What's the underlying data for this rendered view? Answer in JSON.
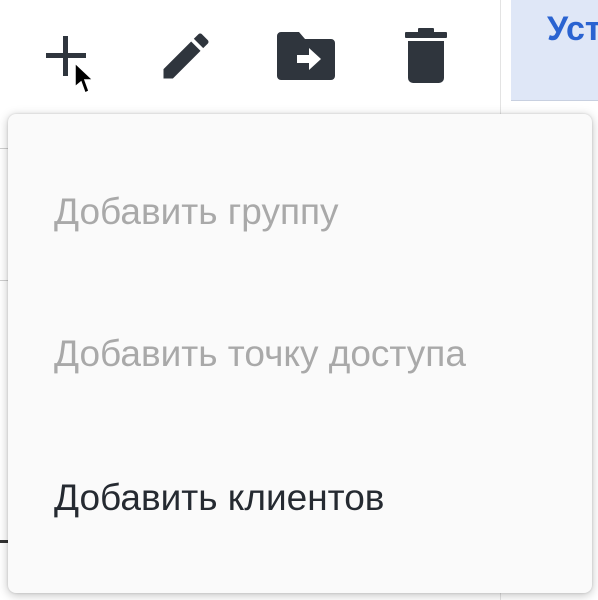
{
  "toolbar": {
    "add_icon": "plus-icon",
    "edit_icon": "pencil-icon",
    "move_icon": "folder-move-icon",
    "delete_icon": "trash-icon",
    "icon_color": "#2f353d"
  },
  "right_panel": {
    "header_text": "Уст"
  },
  "menu": {
    "items": [
      {
        "label": "Добавить группу",
        "state": "disabled"
      },
      {
        "label": "Добавить точку доступа",
        "state": "disabled"
      },
      {
        "label": "Добавить клиентов",
        "state": "enabled"
      }
    ],
    "disabled_color": "#a9a9a9",
    "enabled_color": "#252a31"
  }
}
